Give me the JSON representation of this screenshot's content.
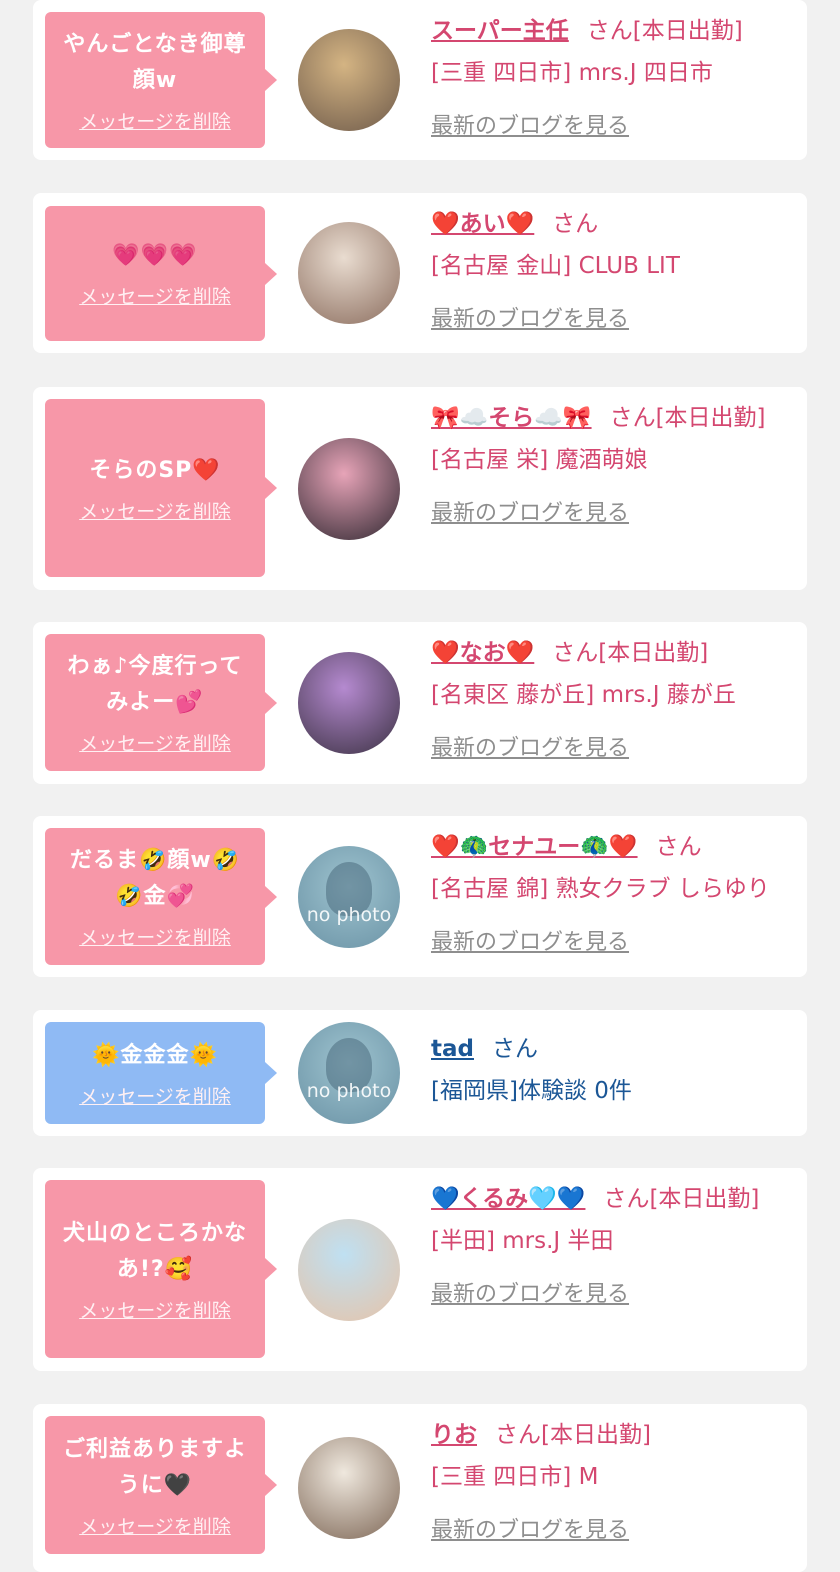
{
  "common": {
    "delete_label": "メッセージを削除",
    "blog_label": "最新のブログを見る"
  },
  "items": [
    {
      "message": "やんごとなき御尊顔w",
      "name": "スーパー主任",
      "suffix": "さん[本日出勤]",
      "location": "[三重 四日市] mrs.J 四日市",
      "has_blog": true,
      "theme": "pink",
      "avatar": "photo",
      "avatar_colors": [
        "#d4b483",
        "#6e5a4a"
      ]
    },
    {
      "message": "💗💗💗",
      "name": "❤️あい❤️",
      "suffix": "さん",
      "location": "[名古屋 金山] CLUB LIT",
      "has_blog": true,
      "theme": "pink",
      "avatar": "photo",
      "avatar_colors": [
        "#e9dcd0",
        "#8b6d5e"
      ]
    },
    {
      "message": "そらのSP❤️",
      "name": "🎀☁️そら☁️🎀",
      "suffix": "さん[本日出勤]",
      "location": "[名古屋 栄] 魔酒萌娘",
      "has_blog": true,
      "theme": "pink",
      "avatar": "photo",
      "avatar_colors": [
        "#e7a4b8",
        "#2f2730"
      ]
    },
    {
      "message": "わぁ♪今度行ってみよー💕",
      "name": "❤️なお❤️",
      "suffix": "さん[本日出勤]",
      "location": "[名東区 藤が丘] mrs.J 藤が丘",
      "has_blog": true,
      "theme": "pink",
      "avatar": "photo",
      "avatar_colors": [
        "#b58ad0",
        "#3b3142"
      ]
    },
    {
      "message": "だるま🤣顔w🤣🤣金💞",
      "name": "❤️🦚セナユー🦚❤️",
      "suffix": "さん",
      "location": "[名古屋 錦] 熟女クラブ しらゆり",
      "has_blog": true,
      "theme": "pink",
      "avatar": "nophoto",
      "avatar_text": "no photo"
    },
    {
      "message": "🌞金金金🌞",
      "name": "tad",
      "suffix": "さん",
      "location": "[福岡県]体験談 0件",
      "has_blog": false,
      "theme": "blue",
      "avatar": "nophoto",
      "avatar_text": "no photo"
    },
    {
      "message": "犬山のところかなあ!?🥰",
      "name": "💙くるみ🩵💙",
      "suffix": "さん[本日出勤]",
      "location": "[半田] mrs.J 半田",
      "has_blog": true,
      "theme": "pink",
      "avatar": "photo",
      "avatar_colors": [
        "#bfe0f2",
        "#e6c3a8"
      ]
    },
    {
      "message": "ご利益ありますように🖤",
      "name": "りお",
      "suffix": "さん[本日出勤]",
      "location": "[三重 四日市] M",
      "has_blog": true,
      "theme": "pink",
      "avatar": "photo",
      "avatar_colors": [
        "#efe8de",
        "#7d6655"
      ]
    }
  ]
}
